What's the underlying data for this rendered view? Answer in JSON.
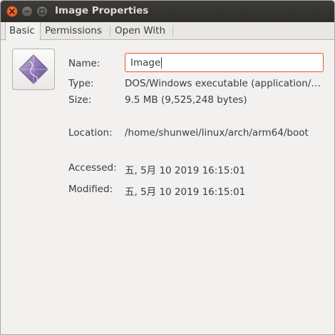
{
  "window": {
    "title": "Image Properties"
  },
  "tabs": [
    {
      "label": "Basic",
      "active": true
    },
    {
      "label": "Permissions",
      "active": false
    },
    {
      "label": "Open With",
      "active": false
    }
  ],
  "file_icon": {
    "icon": "executable-file-icon"
  },
  "properties": {
    "name_label": "Name:",
    "name_value": "Image",
    "type_label": "Type:",
    "type_value": "DOS/Windows executable (application/x-ms-dos-executable)",
    "size_label": "Size:",
    "size_value": "9.5 MB (9,525,248 bytes)",
    "location_label": "Location:",
    "location_value": "/home/shunwei/linux/arch/arm64/boot",
    "accessed_label": "Accessed:",
    "accessed_value": "五, 5月 10 2019 16:15:01",
    "modified_label": "Modified:",
    "modified_value": "五, 5月 10 2019 16:15:01"
  },
  "colors": {
    "accent": "#e95420",
    "titlebar": "#3c3b37",
    "background": "#f2f1f0"
  }
}
